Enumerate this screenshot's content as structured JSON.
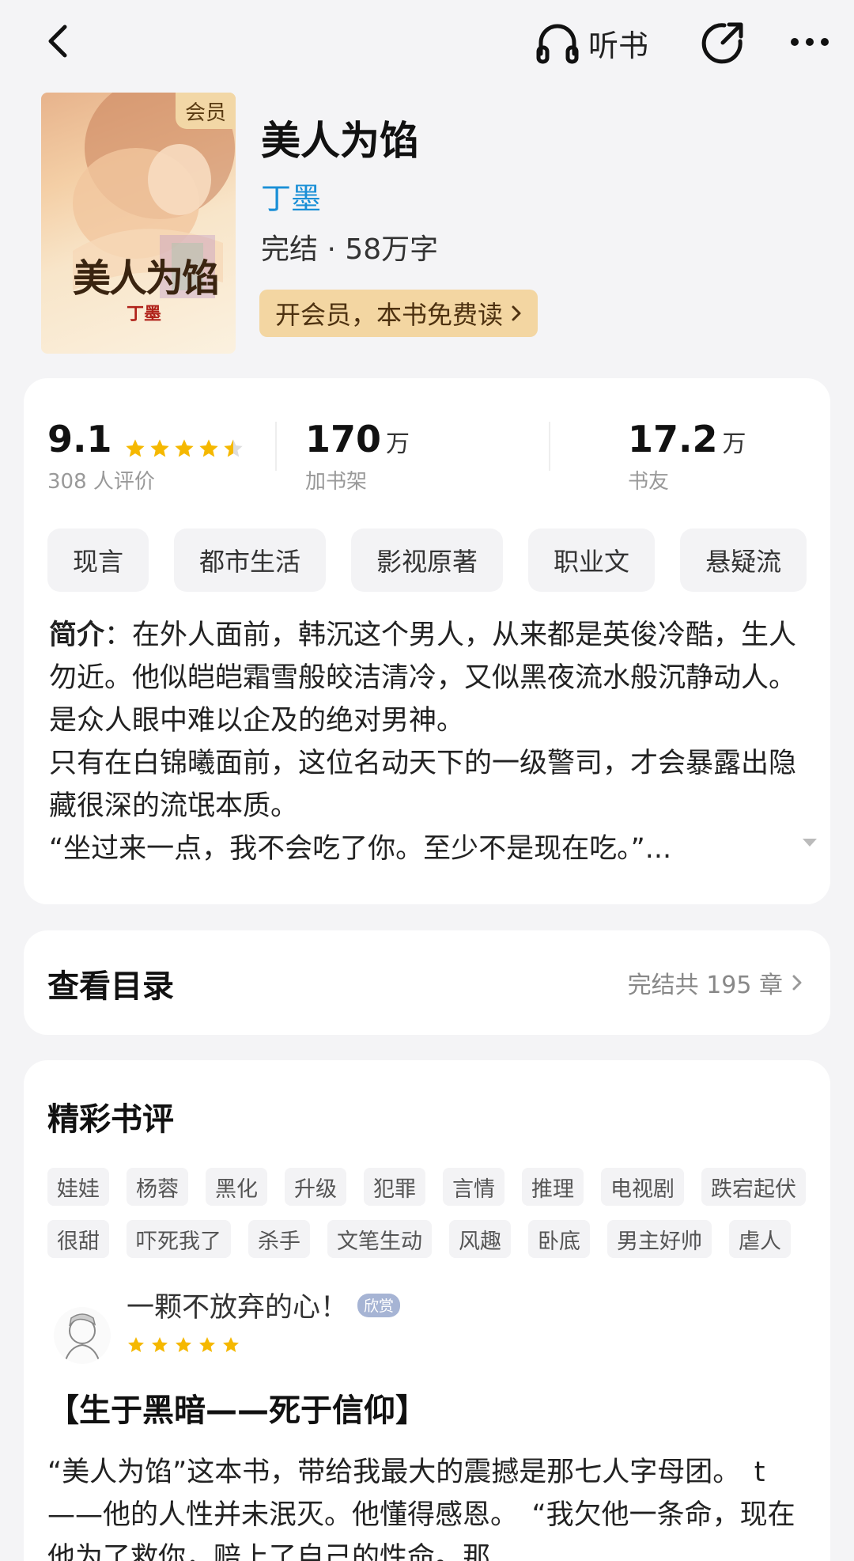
{
  "topbar": {
    "listen_label": "听书"
  },
  "book": {
    "member_tag": "会员",
    "cover_title": "美人为馅",
    "cover_author": "丁墨",
    "title": "美人为馅",
    "author": "丁墨",
    "meta": "完结 · 58万字",
    "vip_cta": "开会员，本书免费读"
  },
  "stats": {
    "rating": "9.1",
    "rating_stars": 4.5,
    "rating_count": "308 人评价",
    "shelf_num": "170",
    "shelf_unit": "万",
    "shelf_label": "加书架",
    "fans_num": "17.2",
    "fans_unit": "万",
    "fans_label": "书友"
  },
  "tags": [
    "现言",
    "都市生活",
    "影视原著",
    "职业文",
    "悬疑流"
  ],
  "intro": {
    "label": "简介",
    "text": "：在外人面前，韩沉这个男人，从来都是英俊冷酷，生人勿近。他似皑皑霜雪般皎洁清冷，又似黑夜流水般沉静动人。是众人眼中难以企及的绝对男神。\n只有在白锦曦面前，这位名动天下的一级警司，才会暴露出隐藏很深的流氓本质。\n“坐过来一点，我不会吃了你。至少不是现在吃。”..."
  },
  "toc": {
    "title": "查看目录",
    "status": "完结共 195 章"
  },
  "reviews": {
    "title": "精彩书评",
    "keywords_row1": [
      "娃娃",
      "杨蓉",
      "黑化",
      "升级",
      "犯罪",
      "言情",
      "推理",
      "电视剧",
      "跌宕起伏"
    ],
    "keywords_row2": [
      "很甜",
      "吓死我了",
      "杀手",
      "文笔生动",
      "风趣",
      "卧底",
      "男主好帅",
      "虐人"
    ],
    "user": "一颗不放弃的心！",
    "badge": "欣赏",
    "stars": 5,
    "headline": "【生于黑暗——死于信仰】",
    "body": "“美人为馅”这本书，带给我最大的震撼是那七人字母团。　t——他的人性并未泯灭。他懂得感恩。　“我欠他一条命，现在他为了救你，赔上了自己的性命。那"
  },
  "colors": {
    "accent": "#1a8fd6",
    "star": "#f5b800",
    "vip_bg": "#f3d6a2",
    "badge": "#a6b4d4"
  }
}
